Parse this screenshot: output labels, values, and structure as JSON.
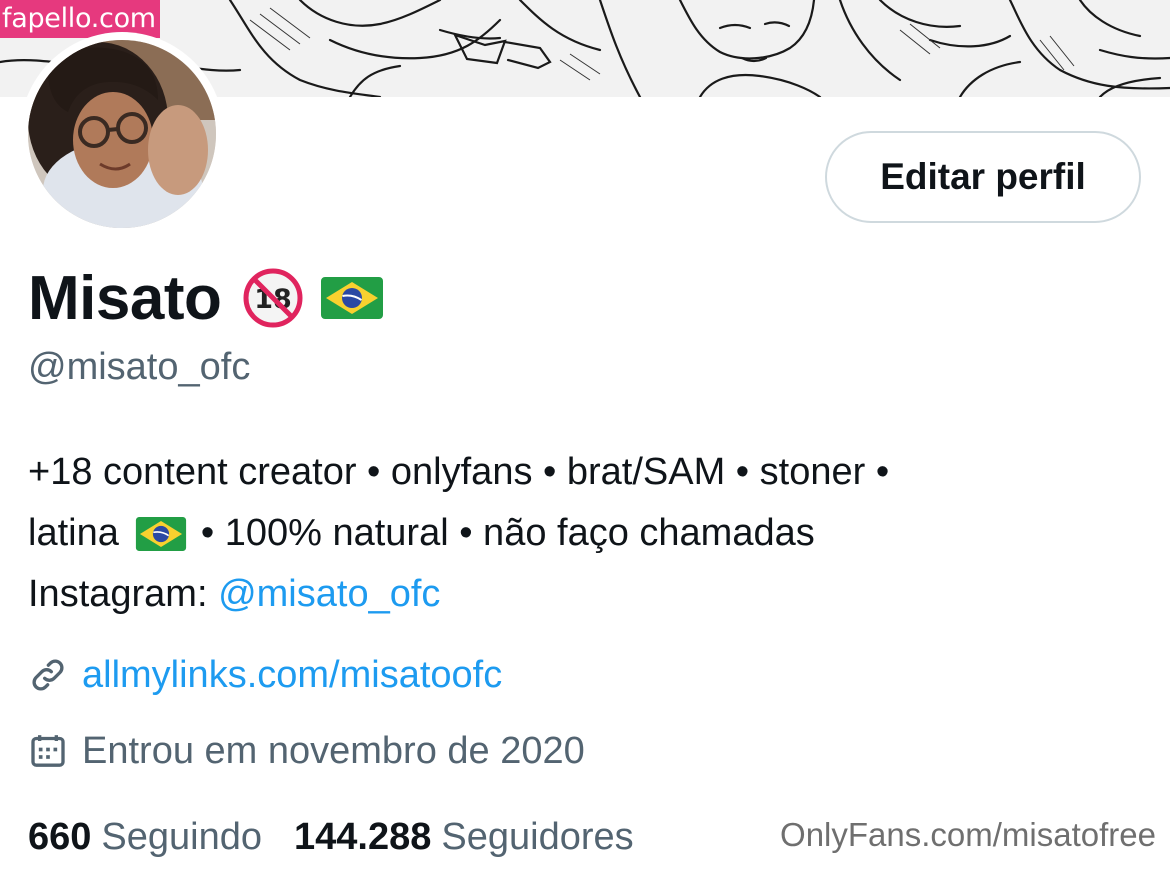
{
  "watermark": "fapello.com",
  "profile": {
    "display_name": "Misato",
    "badges": [
      "no-under-18-emoji",
      "brazil-flag-emoji"
    ],
    "handle": "@misato_ofc",
    "edit_button_label": "Editar perfil",
    "bio": {
      "line1": "+18 content creator • onlyfans • brat/SAM • stoner •",
      "line2_before_flag": "latina",
      "line2_after_flag": "• 100% natural • não faço chamadas",
      "line3_prefix": "Instagram: ",
      "line3_mention": "@misato_ofc"
    },
    "website": "allmylinks.com/misatoofc",
    "joined": "Entrou em novembro de 2020",
    "following_count": "660",
    "following_label": "Seguindo",
    "followers_count": "144.288",
    "followers_label": "Seguidores"
  },
  "icons": {
    "link": "link-icon",
    "calendar": "calendar-icon"
  },
  "footer_watermark": "OnlyFans.com/misatofree",
  "colors": {
    "text_primary": "#0f1419",
    "text_secondary": "#536471",
    "link": "#1d9bf0",
    "button_border": "#cfd9de",
    "watermark_bg": "#e6397e"
  }
}
